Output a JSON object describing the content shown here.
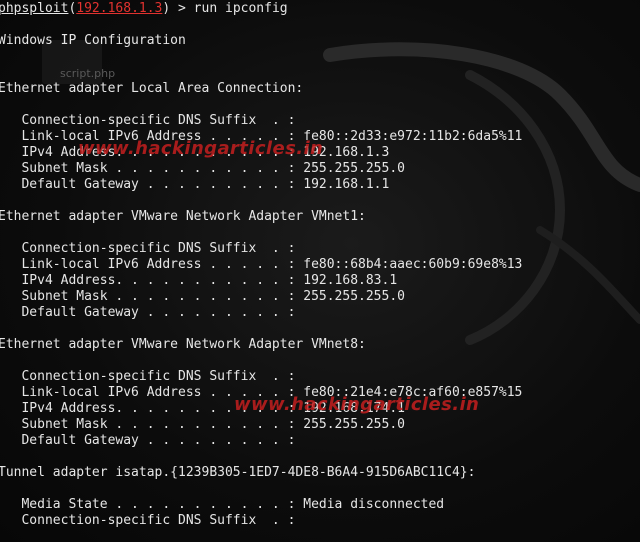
{
  "prompt": {
    "module": "phpsploit",
    "target_ip": "192.168.1.3",
    "suffix": " > run ipconfig"
  },
  "desktop": {
    "icon_label": "script.php"
  },
  "watermark": "www.hackingarticles.in",
  "lines": [
    "Windows IP Configuration",
    "",
    "",
    "Ethernet adapter Local Area Connection:",
    "",
    "   Connection-specific DNS Suffix  . :",
    "   Link-local IPv6 Address . . . . . : fe80::2d33:e972:11b2:6da5%11",
    "   IPv4 Address. . . . . . . . . . . : 192.168.1.3",
    "   Subnet Mask . . . . . . . . . . . : 255.255.255.0",
    "   Default Gateway . . . . . . . . . : 192.168.1.1",
    "",
    "Ethernet adapter VMware Network Adapter VMnet1:",
    "",
    "   Connection-specific DNS Suffix  . :",
    "   Link-local IPv6 Address . . . . . : fe80::68b4:aaec:60b9:69e8%13",
    "   IPv4 Address. . . . . . . . . . . : 192.168.83.1",
    "   Subnet Mask . . . . . . . . . . . : 255.255.255.0",
    "   Default Gateway . . . . . . . . . :",
    "",
    "Ethernet adapter VMware Network Adapter VMnet8:",
    "",
    "   Connection-specific DNS Suffix  . :",
    "   Link-local IPv6 Address . . . . . : fe80::21e4:e78c:af60:e857%15",
    "   IPv4 Address. . . . . . . . . . . : 192.168.174.1",
    "   Subnet Mask . . . . . . . . . . . : 255.255.255.0",
    "   Default Gateway . . . . . . . . . :",
    "",
    "Tunnel adapter isatap.{1239B305-1ED7-4DE8-B6A4-915D6ABC11C4}:",
    "",
    "   Media State . . . . . . . . . . . : Media disconnected",
    "   Connection-specific DNS Suffix  . :"
  ]
}
